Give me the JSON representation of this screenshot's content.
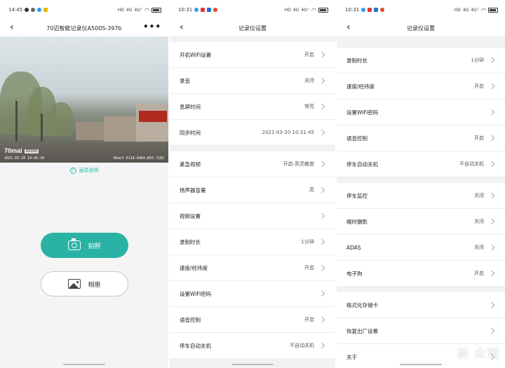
{
  "status_left": {
    "time_a": "14:45",
    "time_b": "10:31",
    "time_c": "10:31"
  },
  "status_right": {
    "net": "4G",
    "signal": "4G⁺",
    "extra": "HD"
  },
  "screen1": {
    "title": "70迈智能记录仪A500S-397b",
    "more": "•••",
    "video": {
      "logo": "70mai",
      "badge": "A500S",
      "timestamp": "2021-03-20  14:45:34",
      "gps": "0km/h E118.6464,N33.7182"
    },
    "quality_label": "画质说明",
    "photo_button": "拍照",
    "album_button": "相册"
  },
  "screen2": {
    "title": "记录仪设置",
    "groups": [
      [
        {
          "label": "开机WiFi设置",
          "value": "开启"
        },
        {
          "label": "录音",
          "value": "关闭"
        },
        {
          "label": "息屏时间",
          "value": "常亮"
        },
        {
          "label": "同步时间",
          "value": "2021-03-20  10:31:45"
        }
      ],
      [
        {
          "label": "紧急视频",
          "value": "开启·高灵敏度"
        },
        {
          "label": "扬声器音量",
          "value": "高"
        },
        {
          "label": "视频设置",
          "value": ""
        },
        {
          "label": "录制时长",
          "value": "1分钟"
        },
        {
          "label": "速度/经纬度",
          "value": "开启"
        },
        {
          "label": "设置WiFi密码",
          "value": ""
        },
        {
          "label": "语音控制",
          "value": "开启"
        },
        {
          "label": "停车自动关机",
          "value": "不自动关机"
        }
      ]
    ]
  },
  "screen3": {
    "title": "记录仪设置",
    "groups": [
      [
        {
          "label": "录制时长",
          "value": "1分钟"
        },
        {
          "label": "速度/经纬度",
          "value": "开启"
        },
        {
          "label": "设置WiFi密码",
          "value": ""
        },
        {
          "label": "语音控制",
          "value": "开启"
        },
        {
          "label": "停车自动关机",
          "value": "不自动关机"
        }
      ],
      [
        {
          "label": "停车监控",
          "value": "关闭"
        },
        {
          "label": "缩时摄影",
          "value": "关闭"
        },
        {
          "label": "ADAS",
          "value": "关闭"
        },
        {
          "label": "电子狗",
          "value": "开启"
        }
      ],
      [
        {
          "label": "格式化存储卡",
          "value": ""
        },
        {
          "label": "恢复出厂设置",
          "value": ""
        },
        {
          "label": "关于",
          "value": ""
        }
      ]
    ],
    "watermark": "新 众观"
  },
  "colors": {
    "accent": "#2ab3a4",
    "background": "#f2f2f2"
  }
}
